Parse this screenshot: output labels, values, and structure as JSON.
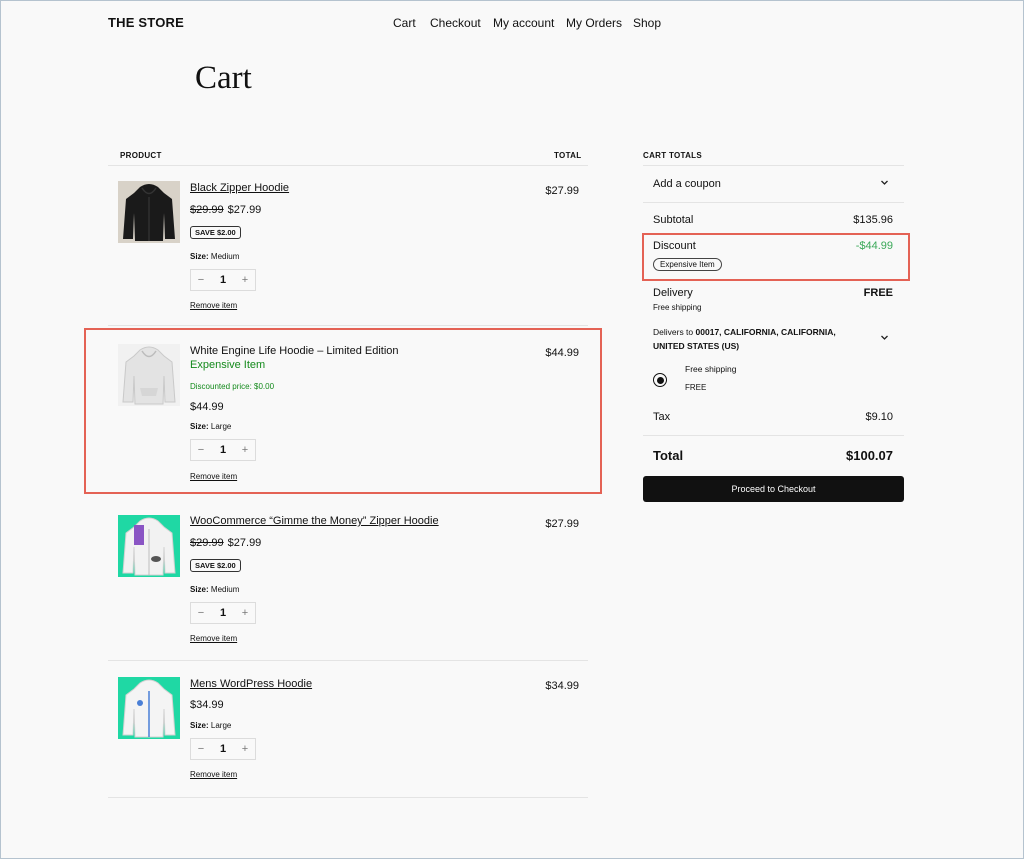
{
  "header": {
    "brand": "THE STORE",
    "nav": [
      "Cart",
      "Checkout",
      "My account",
      "My Orders",
      "Shop"
    ]
  },
  "page_title": "Cart",
  "table": {
    "col_product": "PRODUCT",
    "col_total": "TOTAL"
  },
  "items": [
    {
      "name": "Black Zipper Hoodie",
      "old_price": "$29.99",
      "price": "$27.99",
      "badge": "SAVE $2.00",
      "size_label": "Size:",
      "size": "Medium",
      "qty": "1",
      "remove": "Remove item",
      "total": "$27.99",
      "thumb_color": "#1a1a1a"
    },
    {
      "name": "White Engine Life Hoodie – Limited Edition",
      "tag": "Expensive Item",
      "discount_note": "Discounted price: $0.00",
      "price": "$44.99",
      "size_label": "Size:",
      "size": "Large",
      "qty": "1",
      "remove": "Remove item",
      "total": "$44.99",
      "thumb_color": "#e9e9e9"
    },
    {
      "name": "WooCommerce “Gimme the Money” Zipper Hoodie",
      "old_price": "$29.99",
      "price": "$27.99",
      "badge": "SAVE $2.00",
      "size_label": "Size:",
      "size": "Medium",
      "qty": "1",
      "remove": "Remove item",
      "total": "$27.99",
      "thumb_color": "#1fd8a4"
    },
    {
      "name": "Mens WordPress Hoodie",
      "price": "$34.99",
      "size_label": "Size:",
      "size": "Large",
      "qty": "1",
      "remove": "Remove item",
      "total": "$34.99",
      "thumb_color": "#1fd8a4"
    }
  ],
  "qty_controls": {
    "minus": "−",
    "plus": "+"
  },
  "totals": {
    "heading": "CART TOTALS",
    "coupon": "Add a coupon",
    "subtotal_label": "Subtotal",
    "subtotal": "$135.96",
    "discount_label": "Discount",
    "discount": "-$44.99",
    "discount_tag": "Expensive Item",
    "delivery_label": "Delivery",
    "delivery_value": "FREE",
    "delivery_note": "Free shipping",
    "delivers_to_prefix": "Delivers to",
    "delivers_to_line1": "00017, CALIFORNIA, CALIFORNIA,",
    "delivers_to_line2": "UNITED STATES (US)",
    "shipping_option": "Free shipping",
    "shipping_option_price": "FREE",
    "tax_label": "Tax",
    "tax": "$9.10",
    "total_label": "Total",
    "total": "$100.07",
    "checkout_button": "Proceed to Checkout"
  },
  "colors": {
    "highlight": "#e46255",
    "green_text": "#138a1b",
    "discount_green": "#3aa858",
    "button_bg": "#111111"
  }
}
